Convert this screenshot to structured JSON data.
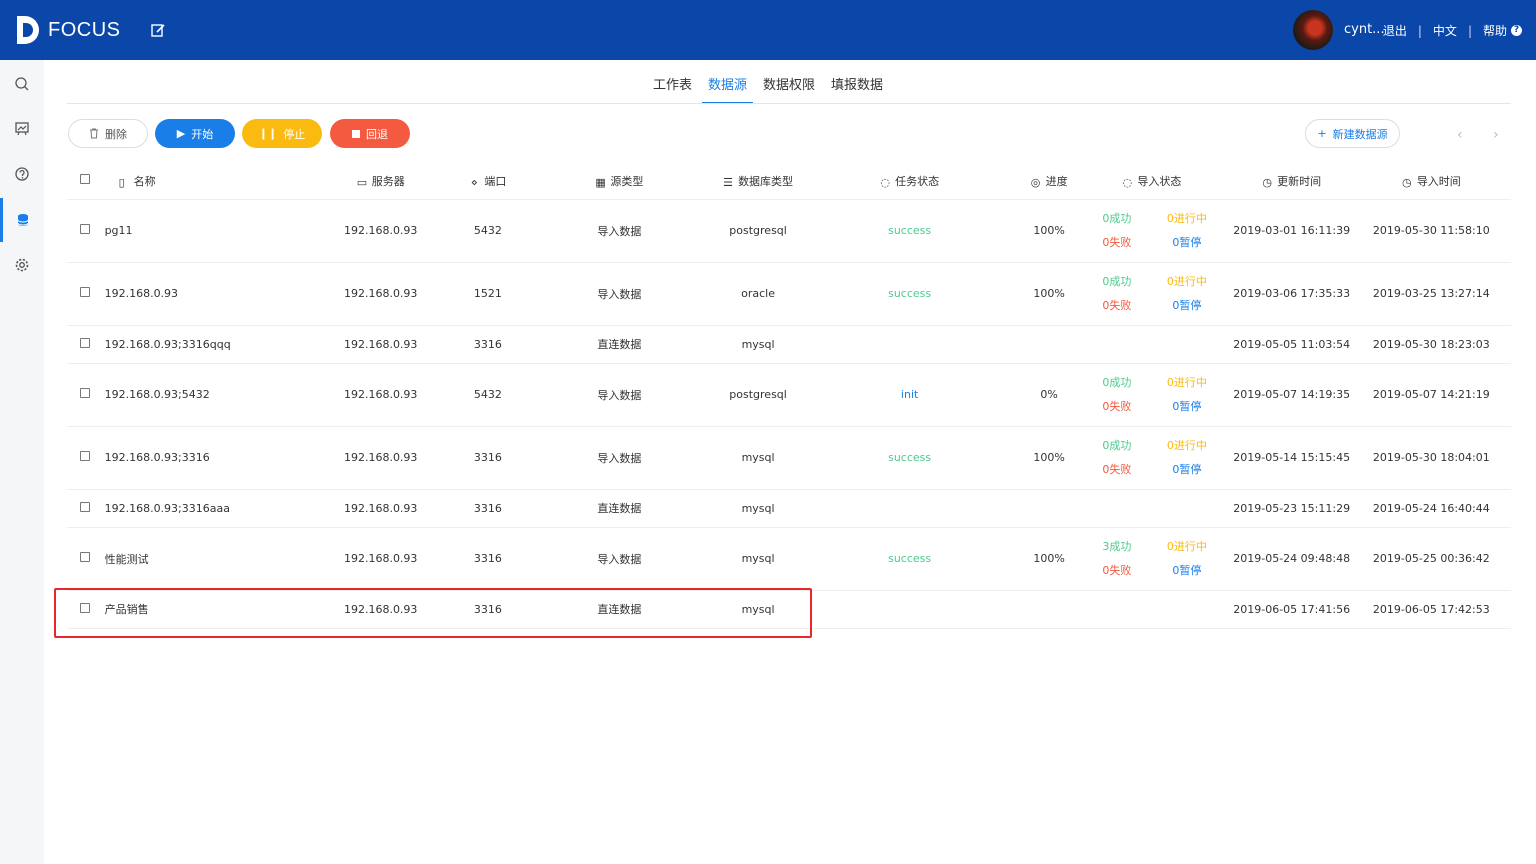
{
  "app": {
    "name": "FOCUS",
    "user": "cynt...",
    "logout": "退出",
    "lang": "中文",
    "help": "帮助"
  },
  "tabs": [
    {
      "label": "工作表",
      "active": false
    },
    {
      "label": "数据源",
      "active": true
    },
    {
      "label": "数据权限",
      "active": false
    },
    {
      "label": "填报数据",
      "active": false
    }
  ],
  "toolbar": {
    "delete": "删除",
    "start": "开始",
    "stop": "停止",
    "rollback": "回退",
    "new_source": "新建数据源"
  },
  "columns": {
    "name": "名称",
    "server": "服务器",
    "port": "端口",
    "source_type": "源类型",
    "db_type": "数据库类型",
    "task_status": "任务状态",
    "progress": "进度",
    "import_status": "导入状态",
    "updated": "更新时间",
    "imported": "导入时间"
  },
  "rows": [
    {
      "name": "pg11",
      "server": "192.168.0.93",
      "port": "5432",
      "source_type": "导入数据",
      "db_type": "postgresql",
      "status": "success",
      "progress": "100%",
      "imp": [
        "0成功",
        "0进行中",
        "0失败",
        "0暂停"
      ],
      "updated": "2019-03-01 16:11:39",
      "imported": "2019-05-30 11:58:10"
    },
    {
      "name": "192.168.0.93",
      "server": "192.168.0.93",
      "port": "1521",
      "source_type": "导入数据",
      "db_type": "oracle",
      "status": "success",
      "progress": "100%",
      "imp": [
        "0成功",
        "0进行中",
        "0失败",
        "0暂停"
      ],
      "updated": "2019-03-06 17:35:33",
      "imported": "2019-03-25 13:27:14"
    },
    {
      "name": "192.168.0.93;3316qqq",
      "server": "192.168.0.93",
      "port": "3316",
      "source_type": "直连数据",
      "db_type": "mysql",
      "status": "",
      "progress": "",
      "imp": null,
      "updated": "2019-05-05 11:03:54",
      "imported": "2019-05-30 18:23:03"
    },
    {
      "name": "192.168.0.93;5432",
      "server": "192.168.0.93",
      "port": "5432",
      "source_type": "导入数据",
      "db_type": "postgresql",
      "status": "init",
      "progress": "0%",
      "imp": [
        "0成功",
        "0进行中",
        "0失败",
        "0暂停"
      ],
      "updated": "2019-05-07 14:19:35",
      "imported": "2019-05-07 14:21:19"
    },
    {
      "name": "192.168.0.93;3316",
      "server": "192.168.0.93",
      "port": "3316",
      "source_type": "导入数据",
      "db_type": "mysql",
      "status": "success",
      "progress": "100%",
      "imp": [
        "0成功",
        "0进行中",
        "0失败",
        "0暂停"
      ],
      "updated": "2019-05-14 15:15:45",
      "imported": "2019-05-30 18:04:01"
    },
    {
      "name": "192.168.0.93;3316aaa",
      "server": "192.168.0.93",
      "port": "3316",
      "source_type": "直连数据",
      "db_type": "mysql",
      "status": "",
      "progress": "",
      "imp": null,
      "updated": "2019-05-23 15:11:29",
      "imported": "2019-05-24 16:40:44"
    },
    {
      "name": "性能测试",
      "server": "192.168.0.93",
      "port": "3316",
      "source_type": "导入数据",
      "db_type": "mysql",
      "status": "success",
      "progress": "100%",
      "imp": [
        "3成功",
        "0进行中",
        "0失败",
        "0暂停"
      ],
      "updated": "2019-05-24 09:48:48",
      "imported": "2019-05-25 00:36:42"
    },
    {
      "name": "产品销售",
      "server": "192.168.0.93",
      "port": "3316",
      "source_type": "直连数据",
      "db_type": "mysql",
      "status": "",
      "progress": "",
      "imp": null,
      "updated": "2019-06-05 17:41:56",
      "imported": "2019-06-05 17:42:53"
    }
  ],
  "colors": {
    "primary": "#0a47a9",
    "accent": "#1a7ee8",
    "success": "#4ccb8c",
    "warn": "#fbba10",
    "danger": "#f35a3f",
    "highlight": "#e8262b"
  }
}
